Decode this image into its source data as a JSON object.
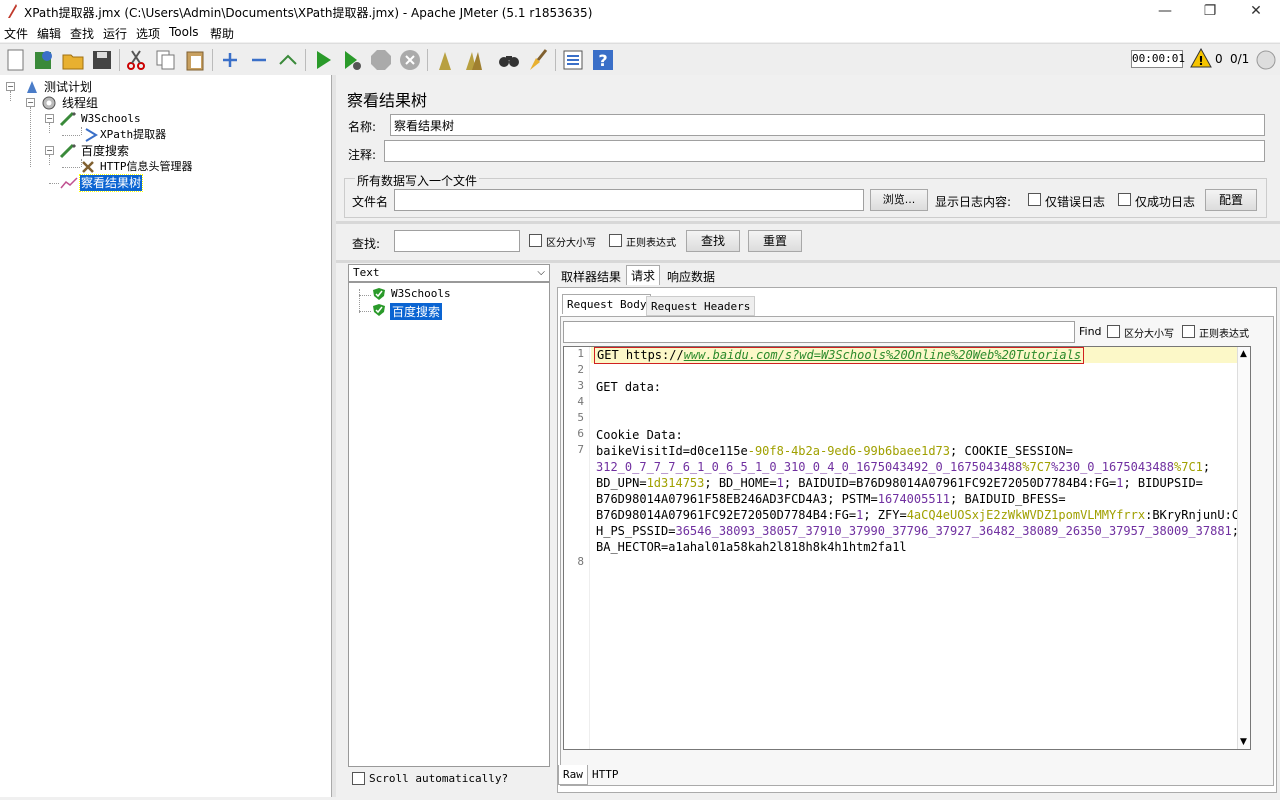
{
  "window": {
    "title": "XPath提取器.jmx (C:\\Users\\Admin\\Documents\\XPath提取器.jmx) - Apache JMeter (5.1 r1853635)",
    "minimize": "—",
    "maximize": "❐",
    "close": "✕"
  },
  "menu": [
    "文件",
    "编辑",
    "查找",
    "运行",
    "选项",
    "Tools",
    "帮助"
  ],
  "toolbar": {
    "timer": "00:00:01",
    "warn_count": "0",
    "threads": "0/1"
  },
  "tree": {
    "test_plan": "测试计划",
    "thread_group": "线程组",
    "w3schools": "W3Schools",
    "xpath": "XPath提取器",
    "baidu": "百度搜索",
    "header_mgr": "HTTP信息头管理器",
    "results_tree": "察看结果树"
  },
  "panel": {
    "title": "察看结果树",
    "name_label": "名称:",
    "name_value": "察看结果树",
    "comment_label": "注释:",
    "file_group": "所有数据写入一个文件",
    "file_label": "文件名",
    "browse": "浏览...",
    "log_label": "显示日志内容:",
    "errors_only": "仅错误日志",
    "success_only": "仅成功日志",
    "configure": "配置"
  },
  "search": {
    "label": "查找:",
    "case": "区分大小写",
    "regex": "正则表达式",
    "find_btn": "查找",
    "reset_btn": "重置"
  },
  "results": {
    "renderer": "Text",
    "samples": [
      "W3Schools",
      "百度搜索"
    ],
    "scroll_auto": "Scroll automatically?"
  },
  "tabs": {
    "sampler_result": "取样器结果",
    "request": "请求",
    "response": "响应数据",
    "request_body": "Request Body",
    "request_headers": "Request Headers",
    "find": "Find",
    "find_case": "区分大小写",
    "find_regex": "正则表达式",
    "raw": "Raw",
    "http": "HTTP"
  },
  "code": {
    "line1_get": "GET https://",
    "line1_url": "www.baidu.com/s?wd=W3Schools%20Online%20Web%20Tutorials",
    "line3": "GET data:",
    "line6": "Cookie Data:",
    "l7a": "baikeVisitId=d0ce115e",
    "l7b": "-90f8-4b2a-9ed6-99b6baee1d73",
    "l7c": "; COOKIE_SESSION=",
    "l8a": "312_0_7_7_7_6_1_0_6_5_1_0_310_0_4_0_1675043492_0_1675043488",
    "l8b": "%7C7",
    "l8c": "%230_0_1675043488",
    "l8d": "%7C1",
    "l8e": ";",
    "l9a": "BD_UPN=",
    "l9b": "1d314753",
    "l9c": "; BD_HOME=",
    "l9d": "1",
    "l9e": "; BAIDUID=B76D98014A07961FC92E72050D7784B4:FG=",
    "l9f": "1",
    "l9g": "; BIDUPSID=",
    "l10a": "B76D98014A07961F58EB246AD3FCD4A3; PSTM=",
    "l10b": "1674005511",
    "l10c": "; BAIDUID_BFESS=",
    "l11a": "B76D98014A07961FC92E72050D7784B4:FG=",
    "l11b": "1",
    "l11c": "; ZFY=",
    "l11d": "4aCQ4eUOSxjE2zWkWVDZ1pomVLMMYfrrx",
    "l11e": ":BKryRnjunU:C;",
    "l12a": "H_PS_PSSID=",
    "l12b": "36546_38093_38057_37910_37990_37796_37927_36482_38089_26350_37957_38009_37881",
    "l12c": ";",
    "l13": "BA_HECTOR=a1ahal01a58kah2l818h8k4h1htm2fa1l",
    "line_numbers": [
      "1",
      "2",
      "3",
      "4",
      "5",
      "6",
      "7",
      "8"
    ]
  }
}
